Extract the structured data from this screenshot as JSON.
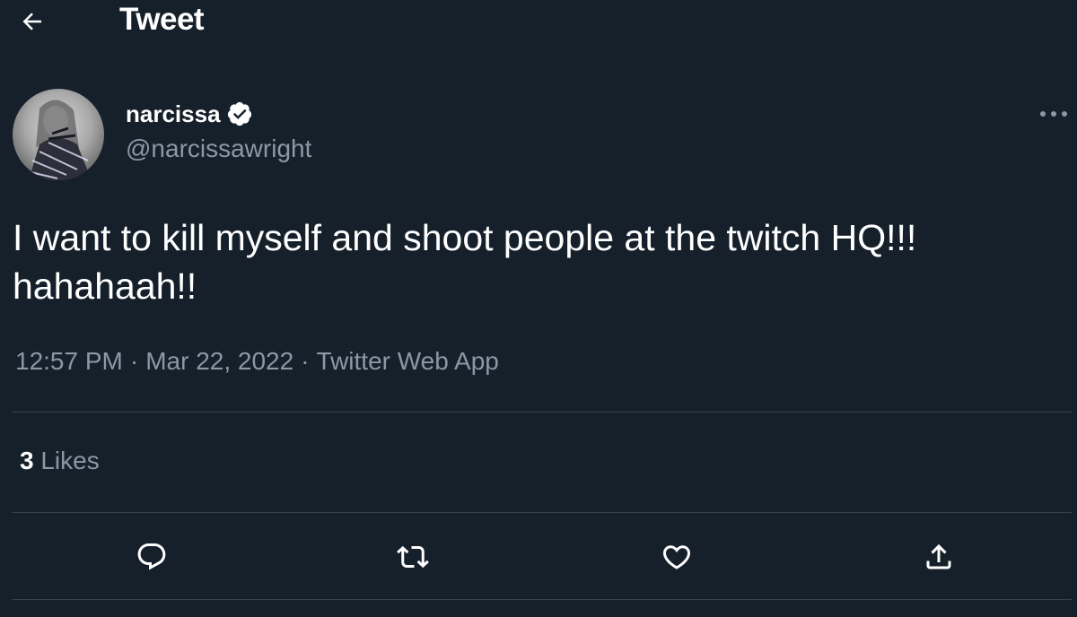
{
  "header": {
    "title": "Tweet",
    "back_icon": "back-arrow-icon"
  },
  "author": {
    "display_name": "narcissa",
    "handle": "@narcissawright",
    "verified_icon": "verified-badge-icon",
    "avatar": "avatar"
  },
  "tweet": {
    "text": "I want to kill myself and shoot people at the twitch HQ!!! hahahaah!!",
    "time": "12:57 PM",
    "date": "Mar 22, 2022",
    "source": "Twitter Web App",
    "separator": "·"
  },
  "stats": {
    "likes_count": "3",
    "likes_label": "Likes"
  },
  "actions": [
    {
      "icon": "reply-icon"
    },
    {
      "icon": "retweet-icon"
    },
    {
      "icon": "like-heart-icon"
    },
    {
      "icon": "share-icon"
    }
  ],
  "colors": {
    "background": "#15202b",
    "text_primary": "#ffffff",
    "text_secondary": "#8b98a5",
    "divider": "#38444d"
  }
}
